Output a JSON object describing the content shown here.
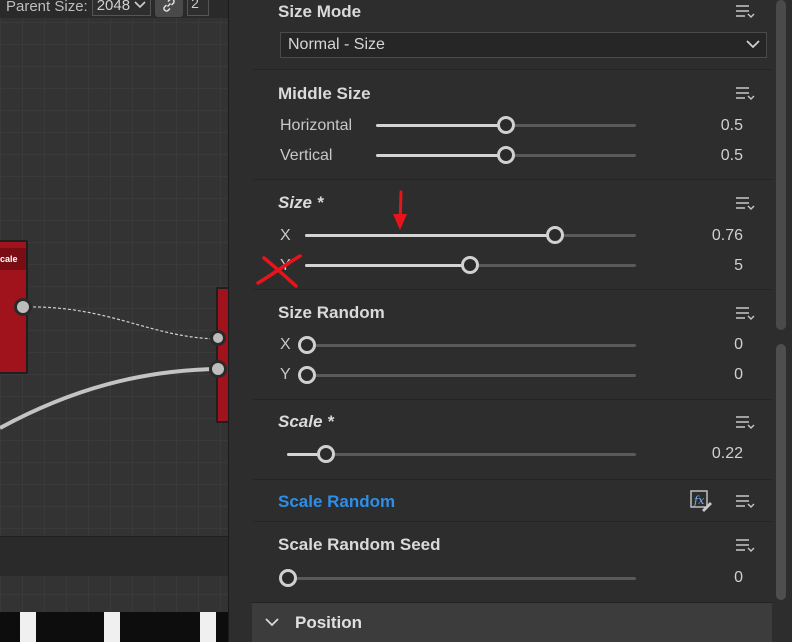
{
  "graph": {
    "parent_size_label": "Parent Size:",
    "parent_size_value": "2048",
    "second_size_value": "2",
    "node_left_label": "cale"
  },
  "panel": {
    "size_mode": {
      "title": "Size Mode",
      "dropdown_value": "Normal - Size"
    },
    "middle_size": {
      "title": "Middle Size",
      "rows": [
        {
          "label": "Horizontal",
          "value": "0.5",
          "fraction": 0.5
        },
        {
          "label": "Vertical",
          "value": "0.5",
          "fraction": 0.5
        }
      ]
    },
    "size": {
      "title": "Size *",
      "rows": [
        {
          "label": "X",
          "value": "0.76",
          "fraction": 0.76
        },
        {
          "label": "Y",
          "value": "5",
          "fraction": 0.5
        }
      ]
    },
    "size_random": {
      "title": "Size Random",
      "rows": [
        {
          "label": "X",
          "value": "0",
          "fraction": 0
        },
        {
          "label": "Y",
          "value": "0",
          "fraction": 0
        }
      ]
    },
    "scale": {
      "title": "Scale *",
      "value": "0.22",
      "fraction": 0.11
    },
    "scale_random": {
      "title": "Scale Random"
    },
    "scale_random_seed": {
      "title": "Scale Random Seed",
      "value": "0",
      "fraction": 0
    },
    "position": {
      "title": "Position"
    }
  },
  "colors": {
    "accent_blue": "#2f8ee6",
    "node_red": "#a0121c",
    "annotation_red": "#e8141c"
  },
  "icons": {
    "menu": "hamburger-menu-icon",
    "expression": "function-edit-icon",
    "link": "link-icon",
    "chevron": "chevron-down-icon"
  }
}
